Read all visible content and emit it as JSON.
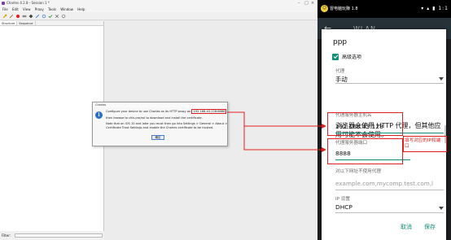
{
  "charles": {
    "window_title": "Charles 4.2.8 - Session 1 *",
    "menu": [
      "File",
      "Edit",
      "View",
      "Proxy",
      "Tools",
      "Window",
      "Help"
    ],
    "tabs": [
      "Structure",
      "Sequence"
    ],
    "filter_label": "Filter:",
    "dialog": {
      "title": "Charles",
      "line1_pre": "Configure your device to use Charles as its HTTP proxy on ",
      "proxy_address": "192.168.43.128:8888",
      "line2": "then browse to chls.pro/ssl to download and install the certificate.",
      "line3": "Note that on iOS 10 and later you must then go into Settings > General > About >",
      "line4": "Certificate Trust Settings and enable the Charles certificate to be trusted.",
      "ok_label": "确定"
    }
  },
  "phone": {
    "status": {
      "left_text": "冒电脑玩赚 1.8",
      "right_text": "▾ ▴ ▮ 1:1"
    },
    "wlan_title": "WLAN",
    "dialog": {
      "ssid": "ppp",
      "advanced_label": "高级选项",
      "proxy_label": "代理",
      "proxy_value": "手动",
      "warning": "浏览器会使用 HTTP 代理，但其他应用可能不会使用。",
      "host_label": "代理服务器主机名",
      "host_value": "192.168.43.128",
      "port_label": "代理服务器端口",
      "port_value": "8888",
      "bypass_label": "对以下网址不使用代理",
      "bypass_placeholder": "example.com,mycomp.test.com,l",
      "ip_label": "IP 设置",
      "ip_value": "DHCP",
      "cancel_label": "取消",
      "save_label": "保存"
    },
    "annotation": "填写对应的IP和端口"
  },
  "colors": {
    "accent": "#0f8f76",
    "annotation_red": "#e02020",
    "toolbar_bg": "#263238"
  },
  "icons": [
    "wrench-icon",
    "record-icon",
    "throttle-icon",
    "breakpoint-icon",
    "pen-icon",
    "refresh-icon",
    "check-icon",
    "tools-icon",
    "gear-icon",
    "back-arrow-icon",
    "info-icon",
    "checkbox-icon",
    "dropdown-arrow-icon"
  ]
}
